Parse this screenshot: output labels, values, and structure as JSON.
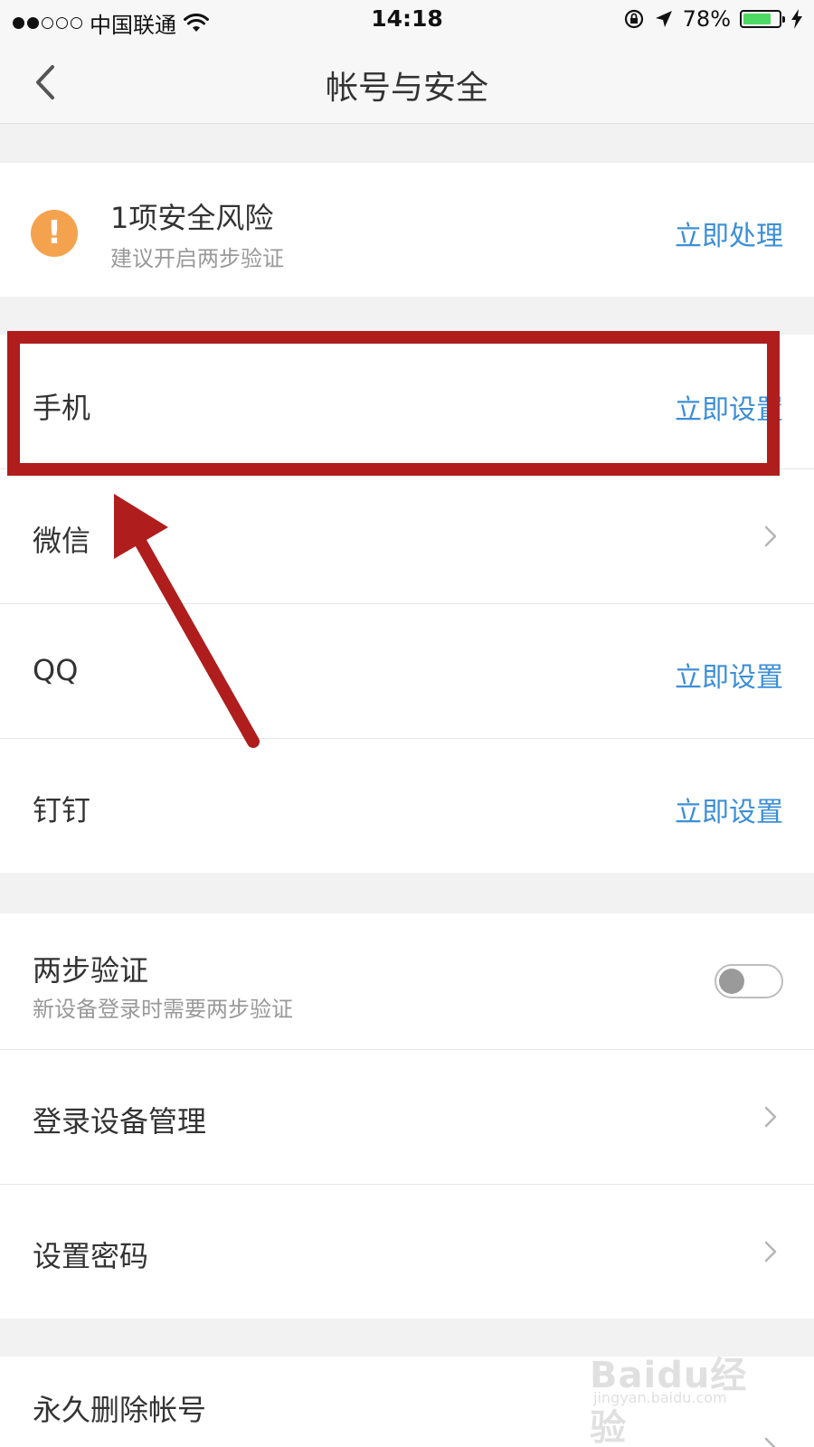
{
  "status_bar": {
    "carrier": "中国联通",
    "time": "14:18",
    "battery_percent": "78%",
    "battery_level": 0.78,
    "signal_icon": "signal-dots-icon",
    "wifi_icon": "wifi-icon",
    "rotation_lock_icon": "rotation-lock-icon",
    "location_icon": "location-arrow-icon",
    "charging_icon": "charging-bolt-icon",
    "battery_color": "#4cd964"
  },
  "nav": {
    "title": "帐号与安全",
    "back_icon": "chevron-left-icon"
  },
  "risk": {
    "icon": "exclamation-icon",
    "icon_color": "#f5a24f",
    "title": "1项安全风险",
    "subtitle": "建议开启两步验证",
    "action": "立即处理"
  },
  "bindings": {
    "items": [
      {
        "label": "手机",
        "action": "立即设置"
      },
      {
        "label": "微信",
        "action": ""
      },
      {
        "label": "QQ",
        "action": "立即设置"
      },
      {
        "label": "钉钉",
        "action": "立即设置"
      }
    ]
  },
  "security": {
    "two_step": {
      "title": "两步验证",
      "subtitle": "新设备登录时需要两步验证",
      "enabled": false
    },
    "device_management": {
      "label": "登录设备管理"
    },
    "set_password": {
      "label": "设置密码"
    }
  },
  "danger": {
    "delete_account": {
      "label": "永久删除帐号"
    }
  },
  "colors": {
    "accent": "#3d8fd6",
    "annotation": "#b01d1d"
  },
  "watermark": {
    "main": "Baidu经验",
    "sub": "jingyan.baidu.com"
  }
}
